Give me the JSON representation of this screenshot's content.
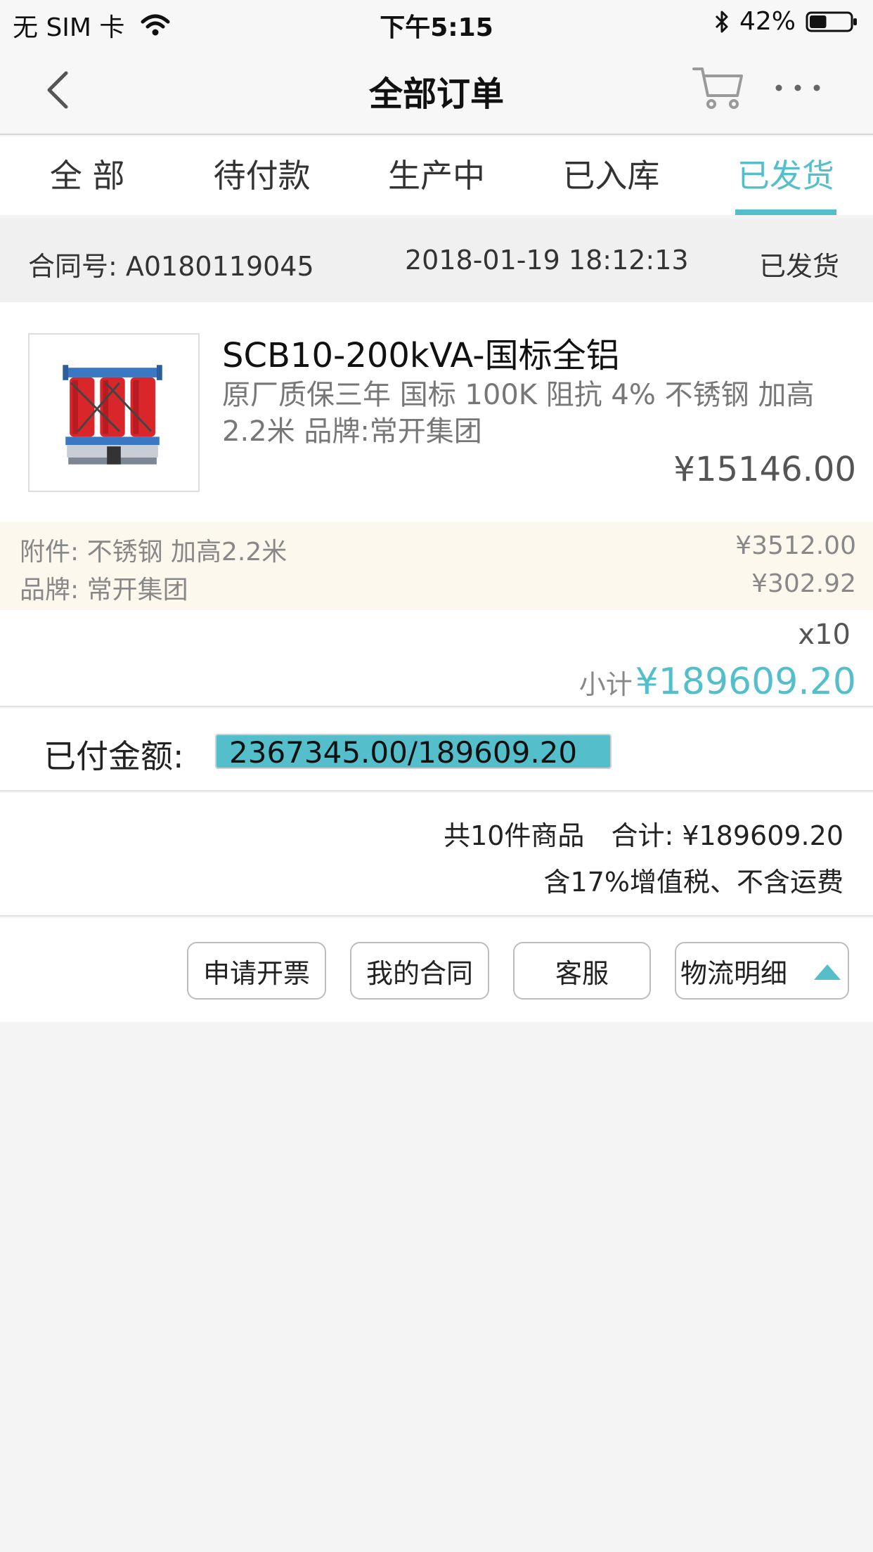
{
  "status_bar": {
    "carrier": "无 SIM 卡",
    "time": "下午5:15",
    "battery": "42%",
    "battery_level": 0.42,
    "wifi_icon": "wifi-icon",
    "bluetooth_icon": "bluetooth-icon",
    "battery_icon": "battery-icon"
  },
  "nav": {
    "title": "全部订单",
    "back_icon": "chevron-left-icon",
    "cart_icon": "cart-icon",
    "more_icon": "more-icon"
  },
  "tabs": [
    {
      "label": "全  部",
      "active": false
    },
    {
      "label": "待付款",
      "active": false
    },
    {
      "label": "生产中",
      "active": false
    },
    {
      "label": "已入库",
      "active": false
    },
    {
      "label": "已发货",
      "active": true
    }
  ],
  "order": {
    "contract_label": "合同号:  A0180119045",
    "datetime": "2018-01-19 18:12:13",
    "status": "已发货",
    "product": {
      "name": "SCB10-200kVA-国标全铝",
      "description": "原厂质保三年 国标 100K 阻抗 4% 不锈钢 加高2.2米 品牌:常开集团",
      "price": "¥15146.00"
    },
    "accessories": [
      {
        "label": "附件:  不锈钢 加高2.2米",
        "price": "¥3512.00"
      },
      {
        "label": "品牌:  常开集团",
        "price": "¥302.92"
      }
    ],
    "quantity": "x10",
    "subtotal_label": "小计",
    "subtotal": "¥189609.20",
    "paid_label": "已付金额:",
    "paid_text": "2367345.00/189609.20",
    "paid_fraction": 1.0,
    "totals_count": "共10件商品",
    "totals_sum": "合计: ¥189609.20",
    "tax_note": "含17%增值税、不含运费"
  },
  "actions": {
    "invoice": "申请开票",
    "contract": "我的合同",
    "service": "客服",
    "logistics": "物流明细",
    "logistics_icon": "caret-up-icon"
  },
  "colors": {
    "accent": "#54bfcb",
    "background": "#f4f4f4",
    "accessory_bg": "#fdf8ee"
  }
}
